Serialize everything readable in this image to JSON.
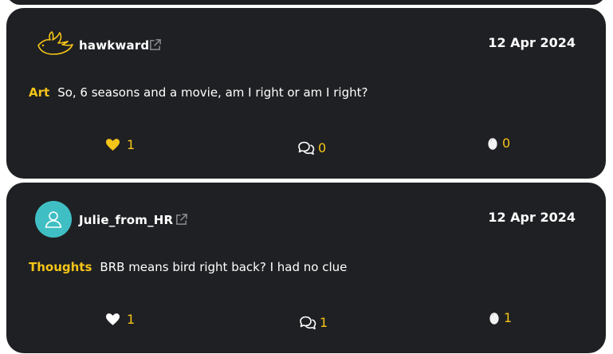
{
  "posts": [
    {
      "username": "hawkward",
      "avatar_icon": "duck-icon",
      "date": "12 Apr 2024",
      "tag": "Art",
      "text": "So, 6 seasons and a movie, am I right or am I right?",
      "likes": "1",
      "liked": true,
      "comments": "0",
      "eggs": "0"
    },
    {
      "username": "Julie_from_HR",
      "avatar_icon": "person-icon",
      "date": "12 Apr 2024",
      "tag": "Thoughts",
      "text": "BRB means bird right back? I had no clue",
      "likes": "1",
      "liked": false,
      "comments": "1",
      "eggs": "1"
    }
  ],
  "colors": {
    "card_bg": "#1f2023",
    "accent": "#f5c518",
    "avatar_teal": "#3fbfc4",
    "icon_grey": "#8a8b90"
  }
}
